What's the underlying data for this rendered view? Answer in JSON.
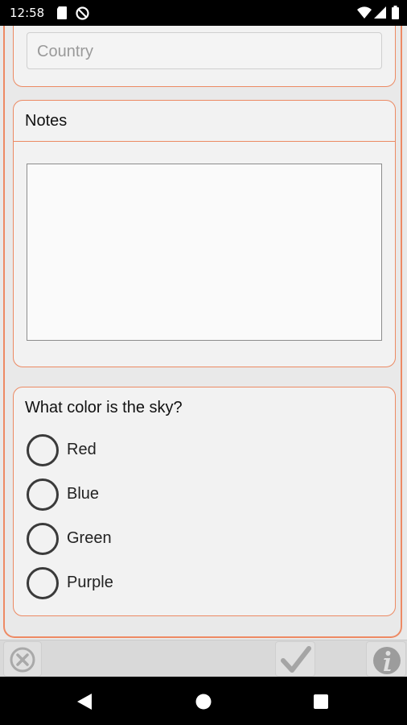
{
  "status_bar": {
    "time": "12:58",
    "left_icons": [
      "sd-card-icon",
      "no-sync-icon"
    ],
    "right_icons": [
      "wifi-icon",
      "signal-icon",
      "battery-icon"
    ]
  },
  "form": {
    "country": {
      "placeholder": "Country",
      "value": ""
    },
    "notes": {
      "title": "Notes",
      "value": ""
    },
    "sky_question": {
      "question": "What color is the sky?",
      "options": [
        "Red",
        "Blue",
        "Green",
        "Purple"
      ],
      "selected": null
    }
  },
  "toolbar": {
    "buttons": [
      "cancel-icon",
      "confirm-check-icon",
      "info-icon"
    ]
  },
  "nav_bar": {
    "buttons": [
      "back-icon",
      "home-icon",
      "recents-icon"
    ]
  },
  "colors": {
    "accent_border": "#ec8a63",
    "card_bg": "#f2f2f2",
    "page_bg": "#e9e9e9"
  }
}
